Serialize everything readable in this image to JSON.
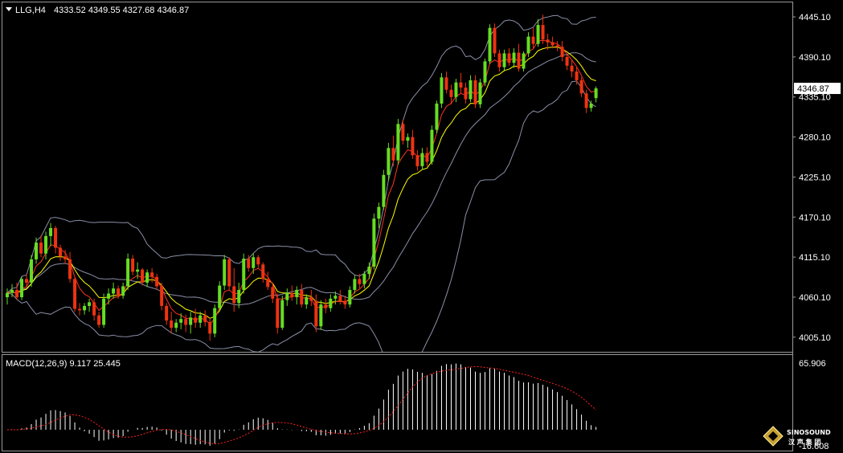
{
  "header": {
    "symbol": "LLG,H4",
    "ohlc": "4333.52 4349.55 4327.68 4346.87"
  },
  "macd_header": "MACD(12,26,9) 9.117 25.445",
  "logo": {
    "name": "SINOSOUND",
    "sub": "汉 声 集 团"
  },
  "colors": {
    "background": "#000000",
    "bull": "#66dd22",
    "bear": "#ee3311",
    "band": "#8a8fa8",
    "ma_fast": "#ff3322",
    "ma_slow": "#ffff00",
    "macd_hist": "#ffffff",
    "macd_signal": "#ff2020",
    "grid_border": "#9a9a9a"
  },
  "chart_data": [
    {
      "type": "candlestick",
      "title": "LLG,H4",
      "ylim": [
        3985,
        4465
      ],
      "y_ticks": [
        4445.1,
        4390.1,
        4335.1,
        4280.1,
        4225.1,
        4170.1,
        4115.1,
        4060.1,
        4005.1
      ],
      "y_tick_labels": [
        "4445.10",
        "4390.10",
        "4335.10",
        "4280.10",
        "4225.10",
        "4170.10",
        "4115.10",
        "4060.10",
        "4005.10"
      ],
      "last_price": 4346.87,
      "last_price_label": "4346.87",
      "ohlc_series": [
        [
          4060,
          4072,
          4050,
          4066
        ],
        [
          4066,
          4078,
          4060,
          4070
        ],
        [
          4070,
          4080,
          4056,
          4060
        ],
        [
          4060,
          4088,
          4056,
          4085
        ],
        [
          4085,
          4092,
          4075,
          4080
        ],
        [
          4080,
          4118,
          4074,
          4112
        ],
        [
          4112,
          4142,
          4106,
          4135
        ],
        [
          4135,
          4145,
          4115,
          4120
        ],
        [
          4120,
          4150,
          4112,
          4144
        ],
        [
          4144,
          4162,
          4130,
          4155
        ],
        [
          4155,
          4158,
          4120,
          4128
        ],
        [
          4128,
          4132,
          4110,
          4116
        ],
        [
          4116,
          4125,
          4106,
          4112
        ],
        [
          4112,
          4122,
          4080,
          4085
        ],
        [
          4085,
          4088,
          4040,
          4044
        ],
        [
          4044,
          4052,
          4035,
          4042
        ],
        [
          4042,
          4052,
          4036,
          4048
        ],
        [
          4048,
          4058,
          4040,
          4053
        ],
        [
          4053,
          4058,
          4028,
          4035
        ],
        [
          4035,
          4040,
          4018,
          4022
        ],
        [
          4022,
          4065,
          4018,
          4058
        ],
        [
          4058,
          4072,
          4050,
          4065
        ],
        [
          4065,
          4080,
          4058,
          4072
        ],
        [
          4072,
          4076,
          4058,
          4062
        ],
        [
          4062,
          4080,
          4058,
          4075
        ],
        [
          4075,
          4120,
          4070,
          4113
        ],
        [
          4113,
          4118,
          4090,
          4095
        ],
        [
          4095,
          4108,
          4085,
          4098
        ],
        [
          4098,
          4100,
          4076,
          4080
        ],
        [
          4080,
          4098,
          4074,
          4094
        ],
        [
          4094,
          4100,
          4080,
          4088
        ],
        [
          4088,
          4092,
          4070,
          4075
        ],
        [
          4075,
          4080,
          4042,
          4048
        ],
        [
          4048,
          4052,
          4022,
          4028
        ],
        [
          4028,
          4040,
          4010,
          4018
        ],
        [
          4018,
          4030,
          4012,
          4025
        ],
        [
          4025,
          4038,
          4016,
          4030
        ],
        [
          4030,
          4036,
          4012,
          4022
        ],
        [
          4022,
          4040,
          4010,
          4032
        ],
        [
          4032,
          4044,
          4018,
          4025
        ],
        [
          4025,
          4040,
          4018,
          4035
        ],
        [
          4035,
          4042,
          4020,
          4026
        ],
        [
          4026,
          4032,
          4000,
          4010
        ],
        [
          4010,
          4050,
          4005,
          4045
        ],
        [
          4045,
          4082,
          4040,
          4076
        ],
        [
          4076,
          4118,
          4070,
          4112
        ],
        [
          4112,
          4115,
          4070,
          4075
        ],
        [
          4075,
          4100,
          4040,
          4052
        ],
        [
          4052,
          4080,
          4045,
          4070
        ],
        [
          4070,
          4120,
          4065,
          4113
        ],
        [
          4113,
          4118,
          4095,
          4100
        ],
        [
          4100,
          4120,
          4092,
          4115
        ],
        [
          4115,
          4118,
          4100,
          4105
        ],
        [
          4105,
          4108,
          4080,
          4085
        ],
        [
          4085,
          4095,
          4070,
          4074
        ],
        [
          4074,
          4080,
          4052,
          4058
        ],
        [
          4058,
          4065,
          4010,
          4018
        ],
        [
          4018,
          4062,
          4015,
          4056
        ],
        [
          4056,
          4072,
          4048,
          4066
        ],
        [
          4066,
          4076,
          4055,
          4060
        ],
        [
          4060,
          4075,
          4050,
          4070
        ],
        [
          4070,
          4078,
          4046,
          4050
        ],
        [
          4050,
          4064,
          4044,
          4060
        ],
        [
          4060,
          4070,
          4048,
          4055
        ],
        [
          4055,
          4064,
          4012,
          4020
        ],
        [
          4020,
          4056,
          4015,
          4050
        ],
        [
          4050,
          4058,
          4038,
          4045
        ],
        [
          4045,
          4064,
          4040,
          4058
        ],
        [
          4058,
          4068,
          4050,
          4062
        ],
        [
          4062,
          4070,
          4050,
          4055
        ],
        [
          4055,
          4062,
          4044,
          4050
        ],
        [
          4050,
          4075,
          4046,
          4070
        ],
        [
          4070,
          4090,
          4065,
          4085
        ],
        [
          4085,
          4092,
          4072,
          4078
        ],
        [
          4078,
          4096,
          4072,
          4092
        ],
        [
          4092,
          4108,
          4085,
          4102
        ],
        [
          4102,
          4175,
          4098,
          4168
        ],
        [
          4168,
          4190,
          4155,
          4184
        ],
        [
          4184,
          4235,
          4180,
          4228
        ],
        [
          4228,
          4272,
          4220,
          4265
        ],
        [
          4265,
          4282,
          4240,
          4248
        ],
        [
          4248,
          4305,
          4242,
          4298
        ],
        [
          4298,
          4304,
          4270,
          4275
        ],
        [
          4275,
          4285,
          4265,
          4280
        ],
        [
          4280,
          4290,
          4250,
          4255
        ],
        [
          4255,
          4262,
          4234,
          4240
        ],
        [
          4240,
          4265,
          4235,
          4258
        ],
        [
          4258,
          4266,
          4240,
          4246
        ],
        [
          4246,
          4296,
          4242,
          4290
        ],
        [
          4290,
          4330,
          4285,
          4326
        ],
        [
          4326,
          4368,
          4320,
          4362
        ],
        [
          4362,
          4370,
          4340,
          4345
        ],
        [
          4345,
          4352,
          4325,
          4335
        ],
        [
          4335,
          4360,
          4328,
          4355
        ],
        [
          4355,
          4368,
          4340,
          4348
        ],
        [
          4348,
          4355,
          4326,
          4332
        ],
        [
          4332,
          4365,
          4328,
          4358
        ],
        [
          4358,
          4365,
          4320,
          4325
        ],
        [
          4325,
          4360,
          4320,
          4355
        ],
        [
          4355,
          4388,
          4350,
          4384
        ],
        [
          4384,
          4435,
          4380,
          4430
        ],
        [
          4430,
          4436,
          4390,
          4395
        ],
        [
          4395,
          4400,
          4370,
          4376
        ],
        [
          4376,
          4400,
          4370,
          4395
        ],
        [
          4395,
          4402,
          4378,
          4382
        ],
        [
          4382,
          4402,
          4375,
          4396
        ],
        [
          4396,
          4408,
          4370,
          4374
        ],
        [
          4374,
          4398,
          4370,
          4395
        ],
        [
          4395,
          4424,
          4390,
          4418
        ],
        [
          4418,
          4430,
          4402,
          4408
        ],
        [
          4408,
          4442,
          4404,
          4434
        ],
        [
          4434,
          4448,
          4408,
          4414
        ],
        [
          4414,
          4422,
          4400,
          4410
        ],
        [
          4410,
          4418,
          4402,
          4406
        ],
        [
          4406,
          4412,
          4398,
          4404
        ],
        [
          4404,
          4412,
          4384,
          4390
        ],
        [
          4390,
          4394,
          4372,
          4378
        ],
        [
          4378,
          4386,
          4362,
          4370
        ],
        [
          4370,
          4376,
          4352,
          4358
        ],
        [
          4358,
          4362,
          4335,
          4340
        ],
        [
          4340,
          4345,
          4313,
          4320
        ],
        [
          4320,
          4330,
          4315,
          4326
        ],
        [
          4333.52,
          4349.55,
          4327.68,
          4346.87
        ]
      ],
      "indicators": [
        "bollinger_upper",
        "bollinger_mid",
        "bollinger_lower",
        "ma_fast",
        "ma_slow"
      ]
    },
    {
      "type": "histogram+line",
      "title": "MACD(12,26,9) 9.117 25.445",
      "ylim": [
        -16.608,
        65.906
      ],
      "y_tick_labels": [
        "65.906",
        "-16.608"
      ],
      "main": 9.117,
      "signal": 25.445
    }
  ]
}
